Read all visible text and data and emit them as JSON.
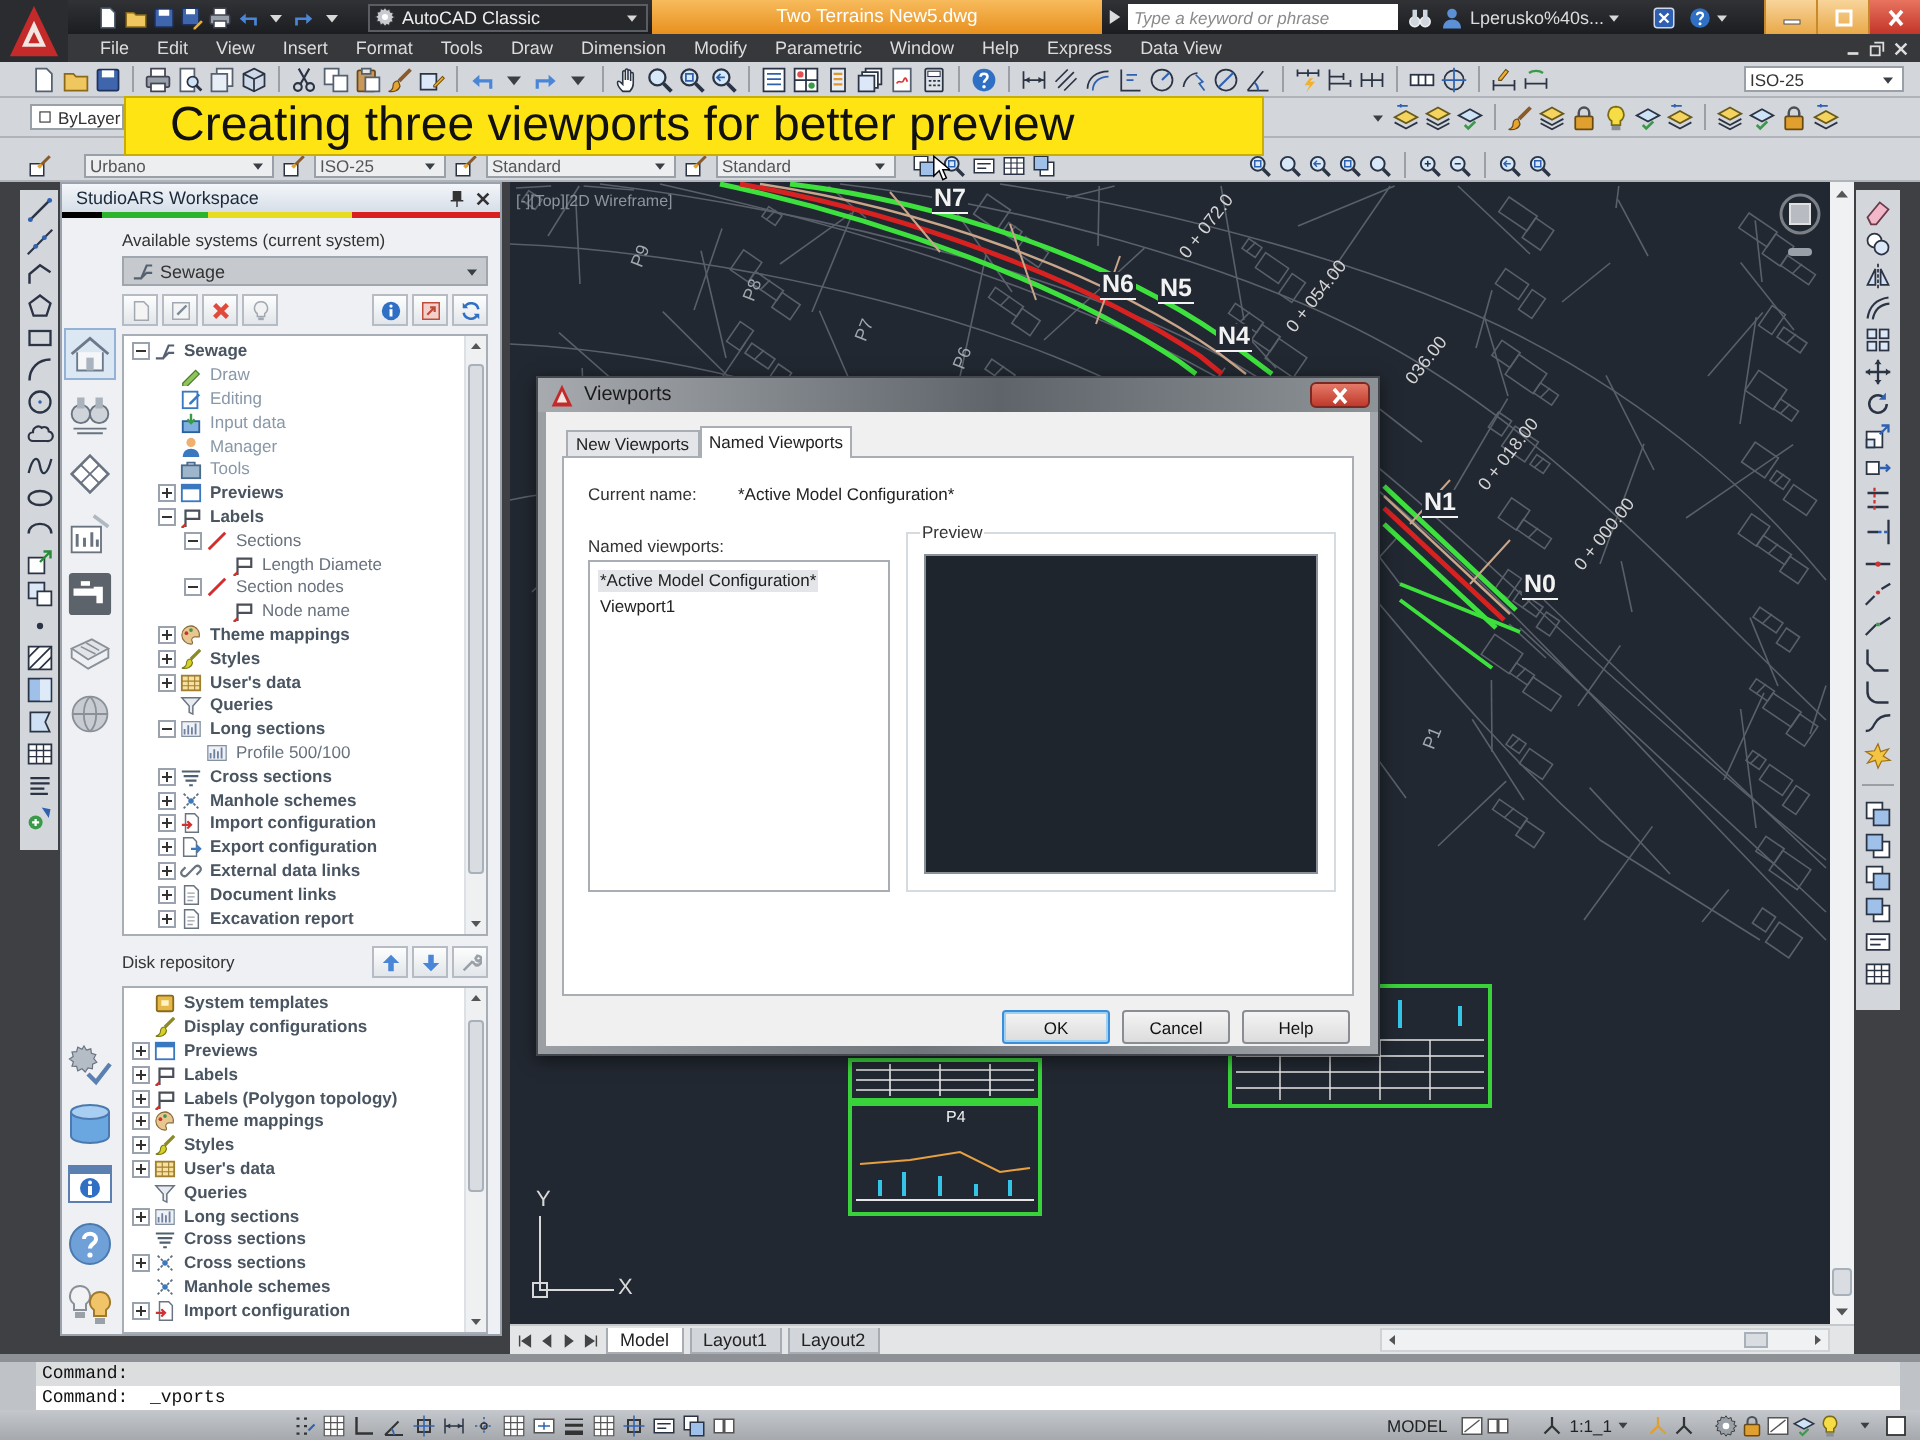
{
  "title_bar": {
    "workspace": "AutoCAD Classic",
    "document": "Two Terrains New5.dwg",
    "search": {
      "placeholder": "Type a keyword or phrase"
    },
    "user": "Lperusko%40s..."
  },
  "menu": [
    "File",
    "Edit",
    "View",
    "Insert",
    "Format",
    "Tools",
    "Draw",
    "Dimension",
    "Modify",
    "Parametric",
    "Window",
    "Help",
    "Express",
    "Data View"
  ],
  "toolbars": {
    "dimension_style": "ISO-25",
    "layer": "ByLayer",
    "text_style": "Urbano",
    "dimension_style_2": "ISO-25",
    "table_style": "Standard",
    "multileader_style": "Standard"
  },
  "caption": "Creating three viewports for better preview",
  "workspace_panel": {
    "title": "StudioARS Workspace",
    "module_tabs": [
      {
        "selected": true
      },
      {
        "selected": false
      },
      {
        "selected": false
      },
      {
        "selected": false
      },
      {
        "selected": false
      },
      {
        "selected": false
      },
      {
        "selected": false
      }
    ],
    "systems_label": "Available systems (current system)",
    "system": "Sewage",
    "tree": [
      {
        "label": "Sewage",
        "kind": "category",
        "expanded": true,
        "children": [
          {
            "label": "Draw",
            "kind": "command"
          },
          {
            "label": "Editing",
            "kind": "command"
          },
          {
            "label": "Input data",
            "kind": "command"
          },
          {
            "label": "Manager",
            "kind": "command"
          },
          {
            "label": "Tools",
            "kind": "command"
          },
          {
            "label": "Previews",
            "kind": "category",
            "expanded": false
          },
          {
            "label": "Labels",
            "kind": "category",
            "expanded": true,
            "children": [
              {
                "label": "Sections",
                "kind": "entry",
                "expanded": true,
                "children": [
                  {
                    "label": "Length Diamete",
                    "kind": "entry"
                  }
                ]
              },
              {
                "label": "Section nodes",
                "kind": "entry",
                "expanded": true,
                "children": [
                  {
                    "label": "Node name",
                    "kind": "entry"
                  }
                ]
              }
            ]
          },
          {
            "label": "Theme mappings",
            "kind": "category",
            "expanded": false
          },
          {
            "label": "Styles",
            "kind": "category",
            "expanded": false
          },
          {
            "label": "User's data",
            "kind": "category",
            "expanded": false
          },
          {
            "label": "Queries",
            "kind": "category"
          },
          {
            "label": "Long sections",
            "kind": "category",
            "expanded": true,
            "children": [
              {
                "label": "Profile 500/100",
                "kind": "entry"
              }
            ]
          },
          {
            "label": "Cross sections",
            "kind": "category",
            "expanded": false
          },
          {
            "label": "Manhole schemes",
            "kind": "category",
            "expanded": false
          },
          {
            "label": "Import configuration",
            "kind": "category",
            "expanded": false
          },
          {
            "label": "Export configuration",
            "kind": "category",
            "expanded": false
          },
          {
            "label": "External data links",
            "kind": "category",
            "expanded": false
          },
          {
            "label": "Document links",
            "kind": "category",
            "expanded": false
          },
          {
            "label": "Excavation report",
            "kind": "category",
            "expanded": false
          }
        ]
      }
    ],
    "repository_label": "Disk repository",
    "repository_tree": [
      {
        "label": "System templates",
        "kind": "category"
      },
      {
        "label": "Display configurations",
        "kind": "category"
      },
      {
        "label": "Previews",
        "kind": "category",
        "expanded": false
      },
      {
        "label": "Labels",
        "kind": "category",
        "expanded": false
      },
      {
        "label": "Labels (Polygon topology)",
        "kind": "category",
        "expanded": false
      },
      {
        "label": "Theme mappings",
        "kind": "category",
        "expanded": false
      },
      {
        "label": "Styles",
        "kind": "category",
        "expanded": false
      },
      {
        "label": "User's data",
        "kind": "category",
        "expanded": false
      },
      {
        "label": "Queries",
        "kind": "category"
      },
      {
        "label": "Long sections",
        "kind": "category",
        "expanded": false
      },
      {
        "label": "Cross sections",
        "kind": "category"
      },
      {
        "label": "Cross sections",
        "kind": "category",
        "expanded": false
      },
      {
        "label": "Manhole schemes",
        "kind": "category"
      },
      {
        "label": "Import configuration",
        "kind": "category",
        "expanded": false
      }
    ]
  },
  "viewport": {
    "label": "[-][Top][2D Wireframe]",
    "nodes": [
      "N7",
      "N6",
      "N5",
      "N4",
      "N1",
      "N0"
    ],
    "stations": [
      "0 + 072.0",
      "0 + 054.00",
      "036.00",
      "0 + 018.00",
      "0 + 000.00"
    ],
    "sections": [
      "P9",
      "P8",
      "P7",
      "P6",
      "P1"
    ],
    "sheet_label": "P4",
    "ucs": {
      "y": "Y",
      "x": "X"
    }
  },
  "layout_tabs": [
    {
      "label": "Model",
      "selected": true
    },
    {
      "label": "Layout1",
      "selected": false
    },
    {
      "label": "Layout2",
      "selected": false
    }
  ],
  "dialog": {
    "title": "Viewports",
    "tabs": [
      {
        "label": "New Viewports",
        "selected": false
      },
      {
        "label": "Named Viewports",
        "selected": true
      }
    ],
    "current_name_label": "Current name:",
    "current_name": "*Active Model Configuration*",
    "list_label": "Named viewports:",
    "viewports": [
      {
        "label": "*Active Model Configuration*",
        "selected": true
      },
      {
        "label": "Viewport1",
        "selected": false
      }
    ],
    "preview_label": "Preview",
    "buttons": [
      {
        "label": "OK",
        "kind": "default"
      },
      {
        "label": "Cancel",
        "kind": "normal"
      },
      {
        "label": "Help",
        "kind": "normal"
      }
    ]
  },
  "command_lines": [
    "Command:",
    "Command:  _vports"
  ],
  "status_bar": {
    "space": "MODEL",
    "annotation_scale": "1:1_1"
  }
}
